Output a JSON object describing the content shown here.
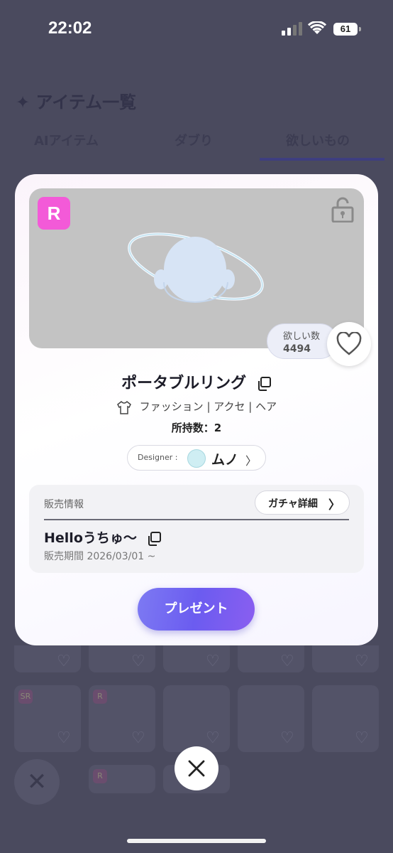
{
  "status_bar": {
    "time": "22:02",
    "battery": "61"
  },
  "background": {
    "title": "✦ アイテム一覧",
    "tabs": [
      "AIアイテム",
      "ダブり",
      "欲しいもの"
    ],
    "active_tab": "欲しいもの",
    "grid_badges": [
      "SR",
      "R",
      "R"
    ]
  },
  "modal": {
    "rarity": "R",
    "rarity_color": "#f35ad8",
    "wish": {
      "label": "欲しい数",
      "count": "4494"
    },
    "item_name": "ポータブルリング",
    "category": "ファッション | アクセ | ヘア",
    "owned": "所持数：2",
    "designer": {
      "label": "Designer :",
      "name": "ムノ"
    },
    "sales": {
      "header": "販売情報",
      "gacha_button": "ガチャ詳細",
      "gacha_name": "Helloうちゅ〜",
      "period": "販売期間 2026/03/01 ~"
    },
    "present_button": "プレゼント"
  },
  "icons": {
    "lock": "lock-icon",
    "heart": "heart-icon",
    "copy": "copy-icon",
    "shirt": "shirt-icon",
    "close": "close-icon",
    "chevron": "chevron-right-icon"
  },
  "colors": {
    "accent": "#6b5cf0",
    "overlay": "#4a4a5e"
  }
}
